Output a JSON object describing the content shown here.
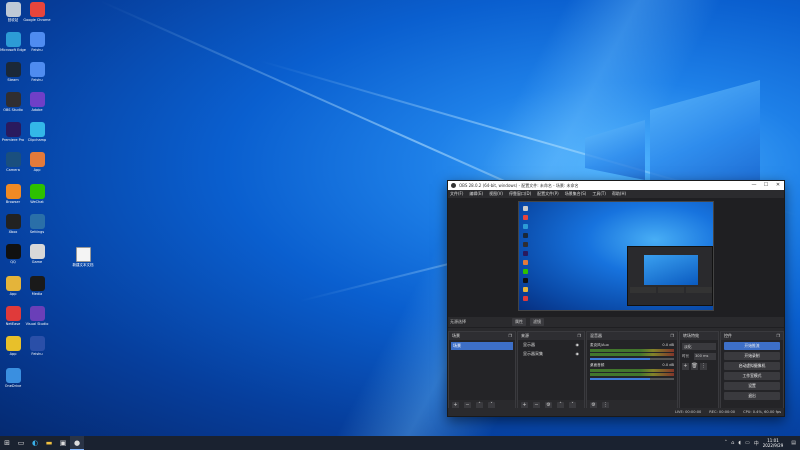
{
  "desktop": {
    "icons": [
      {
        "label": "回收站",
        "color": "#bfc9d6"
      },
      {
        "label": "Google Chrome",
        "color": "#e8453c"
      },
      {
        "label": "Microsoft Edge",
        "color": "#2c9bd6"
      },
      {
        "label": "Feishu",
        "color": "#4f8cf0"
      },
      {
        "label": "Steam",
        "color": "#1b2838"
      },
      {
        "label": "Feishu",
        "color": "#4f8cf0"
      },
      {
        "label": "OBS Studio",
        "color": "#302e31"
      },
      {
        "label": "Adobe",
        "color": "#6f3fc7"
      },
      {
        "label": "Premiere Pro",
        "color": "#2a1a5e"
      },
      {
        "label": "Clipchamp",
        "color": "#33b8e8"
      },
      {
        "label": "Camera",
        "color": "#1a4f7e"
      },
      {
        "label": "App",
        "color": "#e27a3b"
      },
      {
        "label": "Browser",
        "color": "#f08a24"
      },
      {
        "label": "WeChat",
        "color": "#2dc100"
      },
      {
        "label": "Xbox",
        "color": "#222"
      },
      {
        "label": "Settings",
        "color": "#2a6fa8"
      },
      {
        "label": "QQ",
        "color": "#111"
      },
      {
        "label": "Game",
        "color": "#d8d8d8"
      },
      {
        "label": "App",
        "color": "#e4b43a"
      },
      {
        "label": "Media",
        "color": "#1a1a1a"
      },
      {
        "label": "NetEase",
        "color": "#e03a3a"
      },
      {
        "label": "Visual Studio",
        "color": "#6a3fb8"
      },
      {
        "label": "App",
        "color": "#e8c02a"
      },
      {
        "label": "Feishu",
        "color": "#2a4fa8"
      },
      {
        "label": "OneDrive",
        "color": "#3a8fe0"
      }
    ],
    "file_icon": {
      "label": "新建文本文档"
    }
  },
  "obs": {
    "title": "OBS 28.0.2 (64-bit, windows) - 配置文件: 未命名 - 场景: 未命名",
    "window_buttons": [
      "—",
      "☐",
      "✕"
    ],
    "menu": [
      "文件(F)",
      "编辑(E)",
      "视图(V)",
      "停靠窗口(D)",
      "配置文件(P)",
      "场景集合(S)",
      "工具(T)",
      "帮助(H)"
    ],
    "controls_bar": {
      "label": "无源选择",
      "buttons": [
        "属性",
        "滤镜"
      ]
    },
    "scenes": {
      "header": "场景",
      "items": [
        "场景"
      ]
    },
    "sources": {
      "header": "来源",
      "items": [
        "显示器",
        "显示器采集"
      ]
    },
    "mixer": {
      "header": "混音器",
      "channels": [
        {
          "name": "麦克风/Aux",
          "db": "0.0 dB",
          "volume": 0.72
        },
        {
          "name": "桌面音频",
          "db": "0.0 dB",
          "volume": 0.72
        }
      ]
    },
    "transitions": {
      "header": "转场特效",
      "type": "淡化",
      "duration_label": "时长",
      "duration": "300 ms"
    },
    "controls": {
      "header": "控件",
      "buttons": [
        "开始推流",
        "开始录制",
        "启动虚拟摄像机",
        "工作室模式",
        "设置",
        "退出"
      ]
    },
    "status": [
      "LIVE: 00:00:00",
      "REC: 00:00:00",
      "CPU: 0.4%, 60.00 fps"
    ]
  },
  "taskbar": {
    "start_icon": "windows-start-icon",
    "pinned": [
      "task-view-icon",
      "edge-icon",
      "file-explorer-icon",
      "store-icon",
      "obs-icon"
    ],
    "time": "11:01",
    "date": "2022/9/29"
  }
}
